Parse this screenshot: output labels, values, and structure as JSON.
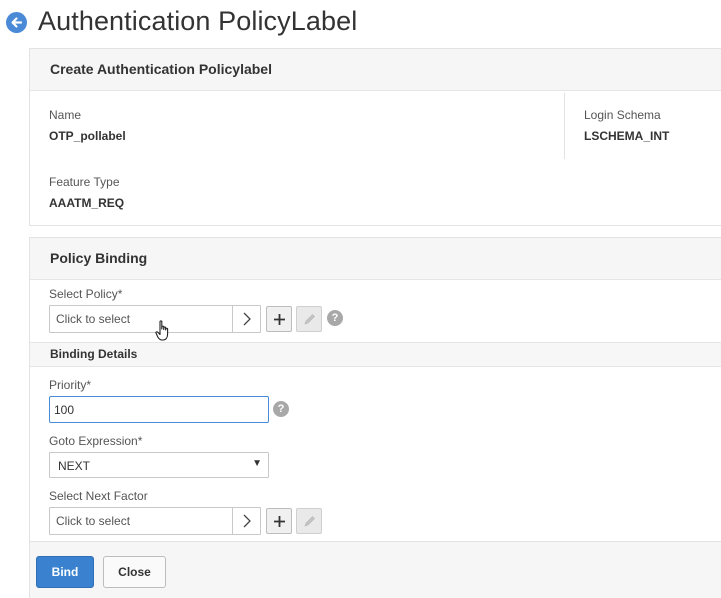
{
  "page": {
    "title": "Authentication PolicyLabel"
  },
  "create_panel": {
    "heading": "Create Authentication Policylabel",
    "name_label": "Name",
    "name_value": "OTP_pollabel",
    "login_schema_label": "Login Schema",
    "login_schema_value": "LSCHEMA_INT",
    "feature_type_label": "Feature Type",
    "feature_type_value": "AAATM_REQ"
  },
  "binding_panel": {
    "heading": "Policy Binding",
    "select_policy_label": "Select Policy*",
    "select_policy_placeholder": "Click to select",
    "binding_details_heading": "Binding Details",
    "priority_label": "Priority*",
    "priority_value": "100",
    "goto_label": "Goto Expression*",
    "goto_value": "NEXT",
    "next_factor_label": "Select Next Factor",
    "next_factor_placeholder": "Click to select",
    "help_glyph": "?"
  },
  "footer": {
    "bind_label": "Bind",
    "close_label": "Close"
  },
  "icons": {
    "back": "back-arrow-icon",
    "arrow": "chevron-right-icon",
    "add": "plus-icon",
    "edit": "pencil-icon",
    "help": "help-icon",
    "caret": "caret-down-icon",
    "cursor": "hand-cursor-icon"
  },
  "colors": {
    "accent": "#3a82d0",
    "back_button": "#4a8ad6",
    "help": "#a8a8a8"
  }
}
